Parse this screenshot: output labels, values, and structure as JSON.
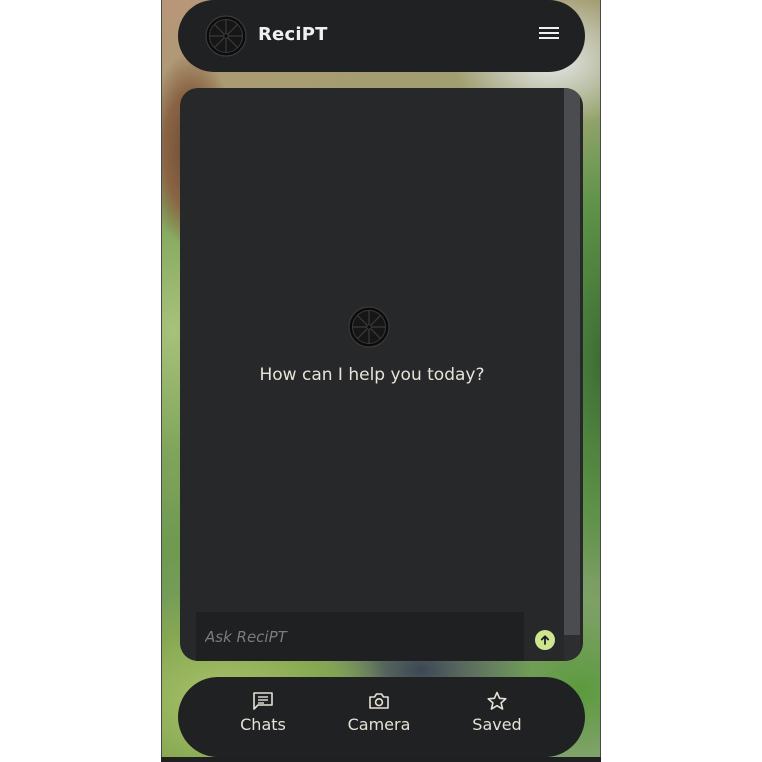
{
  "app": {
    "title": "ReciPT",
    "logo_icon": "citrus-slice-icon",
    "menu_icon": "hamburger-menu-icon"
  },
  "chat": {
    "welcome_message": "How can I help you today?",
    "input": {
      "placeholder": "Ask ReciPT",
      "value": ""
    },
    "send_icon": "arrow-up-icon"
  },
  "bottom_nav": {
    "items": [
      {
        "label": "Chats",
        "icon": "chat-bubble-icon"
      },
      {
        "label": "Camera",
        "icon": "camera-icon"
      },
      {
        "label": "Saved",
        "icon": "star-icon"
      }
    ]
  },
  "colors": {
    "bar_background": "#1f2123",
    "panel_background": "#27282a",
    "send_accent": "#cfe58f",
    "text": "#e8e3d8"
  }
}
